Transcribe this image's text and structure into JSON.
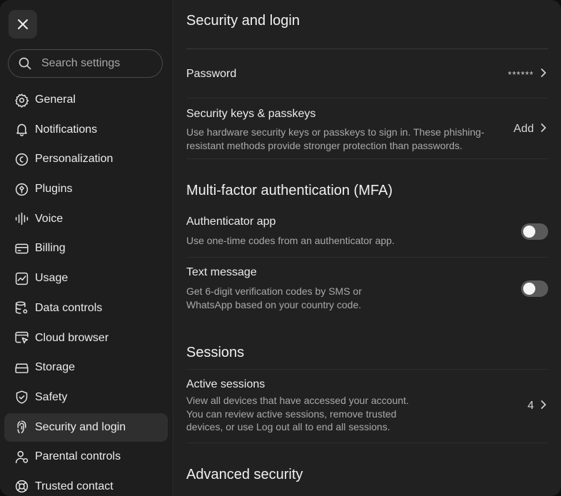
{
  "sidebar": {
    "search_placeholder": "Search settings",
    "items": [
      {
        "label": "General",
        "icon": "gear-icon"
      },
      {
        "label": "Notifications",
        "icon": "bell-icon"
      },
      {
        "label": "Personalization",
        "icon": "personalization-icon"
      },
      {
        "label": "Plugins",
        "icon": "plugins-icon"
      },
      {
        "label": "Voice",
        "icon": "voice-waveform-icon"
      },
      {
        "label": "Billing",
        "icon": "credit-card-icon"
      },
      {
        "label": "Usage",
        "icon": "usage-chart-icon"
      },
      {
        "label": "Data controls",
        "icon": "database-gear-icon"
      },
      {
        "label": "Cloud browser",
        "icon": "cloud-browser-icon"
      },
      {
        "label": "Storage",
        "icon": "storage-drive-icon"
      },
      {
        "label": "Safety",
        "icon": "shield-check-icon"
      },
      {
        "label": "Security and login",
        "icon": "security-login-icon",
        "active": true
      },
      {
        "label": "Parental controls",
        "icon": "parental-user-icon"
      },
      {
        "label": "Trusted contact",
        "icon": "lifebuoy-icon"
      }
    ]
  },
  "main": {
    "title": "Security and login",
    "password": {
      "label": "Password",
      "value": "******"
    },
    "security_keys": {
      "title": "Security keys & passkeys",
      "description_line1": "Use hardware security keys or passkeys to sign in. These phishing-",
      "description_line2": "resistant methods provide stronger protection than passwords.",
      "action": "Add"
    },
    "mfa": {
      "heading": "Multi-factor authentication (MFA)",
      "authenticator": {
        "title": "Authenticator app",
        "description": "Use one-time codes from an authenticator app.",
        "enabled": false
      },
      "text_message": {
        "title": "Text message",
        "description_line1": "Get 6-digit verification codes by SMS or",
        "description_line2": "WhatsApp based on your country code.",
        "enabled": false
      }
    },
    "sessions": {
      "heading": "Sessions",
      "active": {
        "title": "Active sessions",
        "description_line1": "View all devices that have accessed your account.",
        "description_line2": "You can review active sessions, remove trusted",
        "description_line3": "devices, or use Log out all to end all sessions.",
        "count": "4"
      }
    },
    "advanced": {
      "heading": "Advanced security"
    }
  },
  "colors": {
    "background": "#212121",
    "sidebar": "#1e1e1e",
    "active_item": "#2f2f2f",
    "text": "#ececec",
    "muted": "#a9a9a9",
    "toggle_off": "#5a5a5a"
  }
}
